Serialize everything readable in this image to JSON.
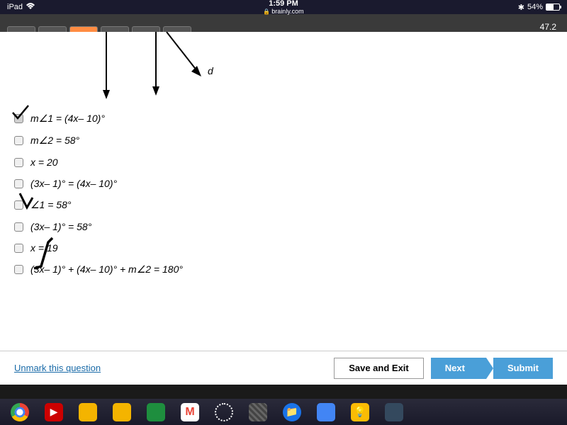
{
  "status": {
    "device": "iPad",
    "time": "1:59 PM",
    "url": "brainly.com",
    "battery_percent": "54%"
  },
  "tab_bar": {
    "score": "47.2"
  },
  "diagram": {
    "label_d": "d"
  },
  "options": [
    {
      "text": "m∠1 = (4x– 10)°",
      "checked": true,
      "marked": true
    },
    {
      "text": "m∠2 = 58°",
      "checked": false,
      "marked": false
    },
    {
      "text": "x = 20",
      "checked": false,
      "marked": false
    },
    {
      "text": "(3x– 1)° = (4x– 10)°",
      "checked": false,
      "marked": false
    },
    {
      "text": "∠1 = 58°",
      "checked": false,
      "marked": true,
      "mark_over_checkbox": true
    },
    {
      "text": "(3x– 1)° = 58°",
      "checked": false,
      "marked": false
    },
    {
      "text": "x = 19",
      "checked": false,
      "marked": true,
      "mark_mid": true
    },
    {
      "text": "(3x– 1)° + (4x– 10)° + m∠2 = 180°",
      "checked": false,
      "marked": true,
      "mark_start": true
    }
  ],
  "buttons": {
    "unmark": "Unmark this question",
    "save_exit": "Save and Exit",
    "next": "Next",
    "submit": "Submit"
  }
}
